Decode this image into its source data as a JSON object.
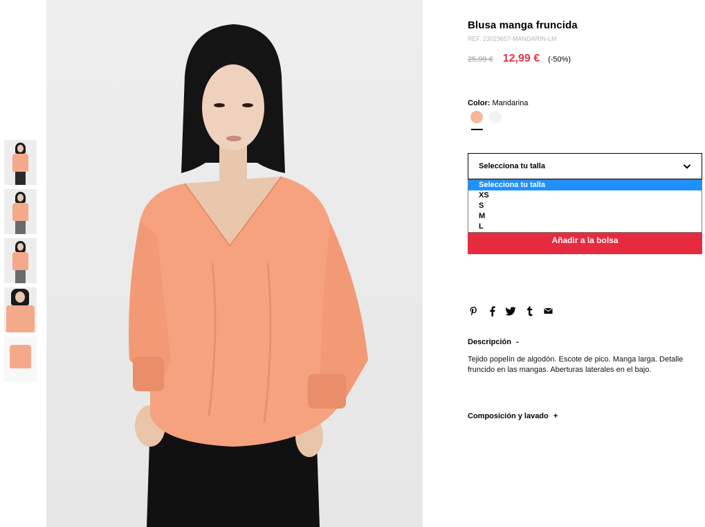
{
  "product": {
    "title": "Blusa manga fruncida",
    "ref": "REF. 23023657-MANDARIN-LM",
    "old_price": "25,99 €",
    "new_price": "12,99 €",
    "discount": "(-50%)"
  },
  "color": {
    "label": "Color:",
    "value": "Mandarina",
    "swatches": [
      {
        "name": "Mandarina",
        "hex": "#f7b79a"
      },
      {
        "name": "Blanco",
        "hex": "#f2f2f2"
      }
    ]
  },
  "size": {
    "select_label": "Selecciona tu talla",
    "options": [
      "Selecciona tu talla",
      "XS",
      "S",
      "M",
      "L"
    ],
    "highlighted_index": 0
  },
  "buttons": {
    "add_to_bag": "Añadir a la bolsa"
  },
  "share": {
    "icons": [
      "pinterest-icon",
      "facebook-icon",
      "twitter-icon",
      "tumblr-icon",
      "email-icon"
    ]
  },
  "description": {
    "title": "Descripción",
    "toggle": "-",
    "text": "Tejido popelín de algodón. Escote de pico. Manga larga. Detalle fruncido en las mangas. Aberturas laterales en el bajo."
  },
  "composition": {
    "title": "Composición y lavado",
    "toggle": "+"
  },
  "colors": {
    "accent_red": "#e72b3f",
    "price_red": "#e53543",
    "highlight_blue": "#1e90ff"
  }
}
